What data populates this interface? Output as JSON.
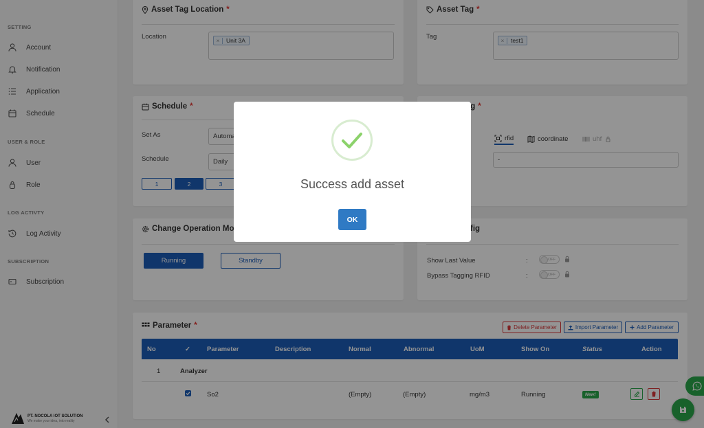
{
  "sidebar": {
    "sections": {
      "setting": "SETTING",
      "user_role": "USER & ROLE",
      "log_activity": "LOG ACTIVTY",
      "subscription": "SUBSCRIPTION"
    },
    "items": {
      "account": "Account",
      "notification": "Notification",
      "application": "Application",
      "schedule": "Schedule",
      "user": "User",
      "role": "Role",
      "log_activity": "Log Activity",
      "subscription": "Subscription"
    },
    "footer": {
      "company": "PT. NOCOLA IOT SOLUTION",
      "tagline": "We make your idea, into reality"
    }
  },
  "asset_tag_location": {
    "title": "Asset Tag Location",
    "required": "*",
    "location_label": "Location",
    "location_chip": "Unit 3A",
    "chip_remove": "×"
  },
  "asset_tag": {
    "title": "Asset Tag",
    "required": "*",
    "tag_label": "Tag",
    "tag_chip": "test1",
    "chip_remove": "×"
  },
  "schedule": {
    "title": "Schedule",
    "required": "*",
    "set_as_label": "Set As",
    "set_as_value": "Automa",
    "schedule_label": "Schedule",
    "schedule_value": "Daily",
    "pages": [
      "1",
      "2",
      "3"
    ]
  },
  "tagging": {
    "title": "ging",
    "required": "*",
    "tabs": {
      "rfid": "rfid",
      "coordinate": "coordinate",
      "uhf": "uhf"
    },
    "value": "-"
  },
  "operation_mode": {
    "title": "Change Operation Mo",
    "running": "Running",
    "standby": "Standby"
  },
  "config": {
    "title": "nfig",
    "show_last_value": "Show Last Value",
    "bypass_tagging": "Bypass Tagging RFID",
    "colon": ":",
    "toggle_off": "OFF"
  },
  "parameter": {
    "title": "Parameter",
    "required": "*",
    "delete_btn": "Delete Parameter",
    "import_btn": "Import Parameter",
    "add_btn": "Add Parameter",
    "headers": {
      "no": "No",
      "check": "✓",
      "parameter": "Parameter",
      "description": "Description",
      "normal": "Normal",
      "abnormal": "Abnormal",
      "uom": "UoM",
      "show_on": "Show On",
      "status": "Status",
      "action": "Action"
    },
    "group": {
      "no": "1",
      "name": "Analyzer"
    },
    "row": {
      "parameter": "So2",
      "normal": "(Empty)",
      "abnormal": "(Empty)",
      "uom": "mg/m3",
      "show_on": "Running",
      "status": "New!"
    }
  },
  "modal": {
    "title": "Success add asset",
    "ok": "OK"
  },
  "colors": {
    "primary": "#1c5db8",
    "success": "#2aa84a",
    "danger": "#e53935",
    "ok_button": "#2f7ac4"
  }
}
